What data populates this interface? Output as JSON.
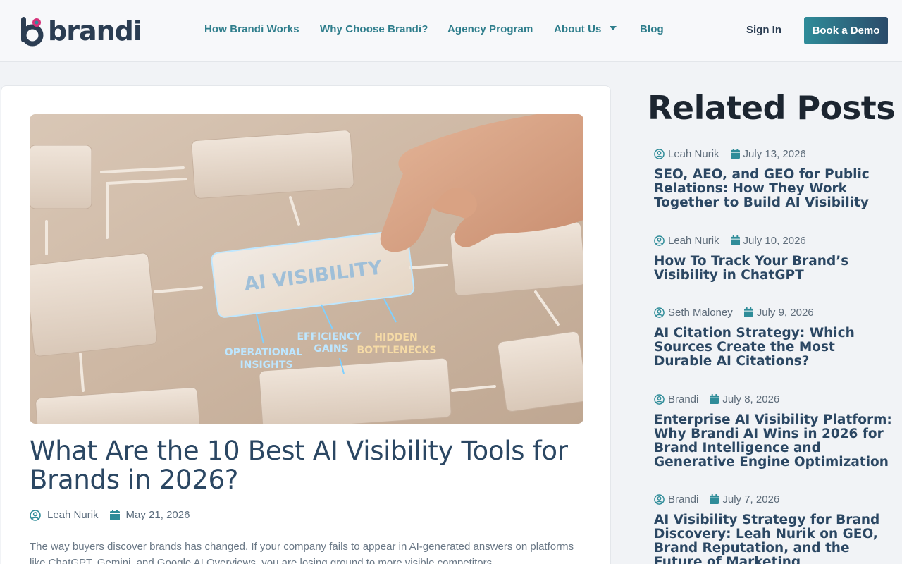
{
  "brand": {
    "name": "brandi",
    "accent": "#2f8c99",
    "magenta": "#d6337a"
  },
  "nav": {
    "items": [
      {
        "label": "How Brandi Works"
      },
      {
        "label": "Why Choose Brandi?"
      },
      {
        "label": "Agency Program"
      },
      {
        "label": "About Us",
        "has_dropdown": true
      },
      {
        "label": "Blog"
      }
    ],
    "signin_label": "Sign In",
    "demo_label": "Book a Demo"
  },
  "article": {
    "image_texts": [
      "AI VISIBILITY",
      "OPERATIONAL",
      "INSIGHTS",
      "EFFICIENCY",
      "GAINS",
      "HIDDEN",
      "BOTTLENECKS"
    ],
    "title": "What Are the 10 Best AI Visibility Tools for Brands in 2026?",
    "author": "Leah Nurik",
    "date": "May 21, 2026",
    "excerpt": "The way buyers discover brands has changed. If your company fails to appear in AI-generated answers on platforms like ChatGPT, Gemini, and Google AI Overviews, you are losing ground to more visible competitors."
  },
  "sidebar": {
    "title": "Related Posts",
    "posts": [
      {
        "author": "Leah Nurik",
        "date": "July 13, 2026",
        "title": "SEO, AEO, and GEO for Public Relations: How They Work Together to Build AI Visibility"
      },
      {
        "author": "Leah Nurik",
        "date": "July 10, 2026",
        "title": "How To Track Your Brand’s Visibility in ChatGPT"
      },
      {
        "author": "Seth Maloney",
        "date": "July 9, 2026",
        "title": "AI Citation Strategy: Which Sources Create the Most Durable AI Citations?"
      },
      {
        "author": "Brandi",
        "date": "July 8, 2026",
        "title": "Enterprise AI Visibility Platform: Why Brandi AI Wins in 2026 for Brand Intelligence and Generative Engine Optimization"
      },
      {
        "author": "Brandi",
        "date": "July 7, 2026",
        "title": "AI Visibility Strategy for Brand Discovery: Leah Nurik on GEO, Brand Reputation, and the Future of Marketing"
      }
    ]
  }
}
